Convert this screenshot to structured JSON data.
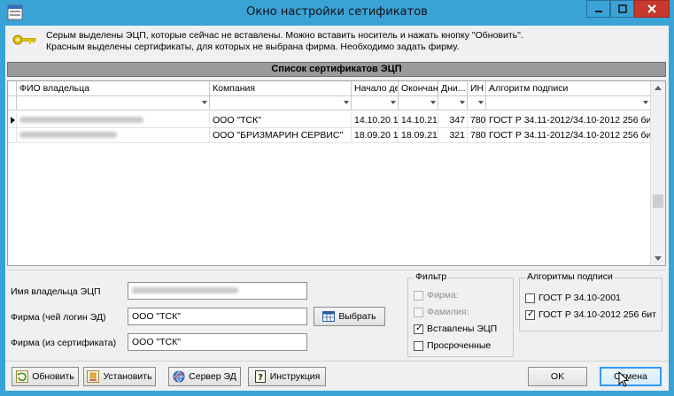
{
  "window": {
    "title": "Окно настройки сетификатов"
  },
  "info": {
    "line1": "Серым выделены ЭЦП, которые сейчас не вставлены. Можно вставить носитель и нажать кнопку \"Обновить\".",
    "line2": "Красным выделены сертификаты, для которых не выбрана фирма. Необходимо задать фирму."
  },
  "grid": {
    "title": "Список сертификатов ЭЦП",
    "columns": [
      "ФИО владельца",
      "Компания",
      "Начало де",
      "Окончан",
      "Дни...",
      "ИН",
      "Алгоритм подписи"
    ],
    "rows": [
      {
        "owner": "",
        "company": "ООО \"ТСК\"",
        "start": "14.10.20 1",
        "end": "14.10.21 '",
        "days": "347",
        "inn": "780",
        "algo": "ГОСТ Р 34.11-2012/34.10-2012 256 бит"
      },
      {
        "owner": "",
        "company": "ООО \"БРИЗМАРИН СЕРВИС\"",
        "start": "18.09.20 1",
        "end": "18.09.21 '",
        "days": "321",
        "inn": "780",
        "algo": "ГОСТ Р 34.11-2012/34.10-2012 256 бит"
      }
    ]
  },
  "form": {
    "owner_label": "Имя владельца ЭЦП",
    "owner_value": "",
    "firm_login_label": "Фирма (чей логин ЭД)",
    "firm_login_value": "ООО \"ТСК\"",
    "select_button": "Выбрать",
    "firm_cert_label": "Фирма (из сертификата)",
    "firm_cert_value": "ООО \"ТСК\""
  },
  "filter": {
    "title": "Фильтр",
    "items": [
      {
        "label": "Фирма:",
        "checked": false,
        "disabled": true
      },
      {
        "label": "Фамилия:",
        "checked": false,
        "disabled": true
      },
      {
        "label": "Вставлены ЭЦП",
        "checked": true,
        "disabled": false
      },
      {
        "label": "Просроченные",
        "checked": false,
        "disabled": false
      }
    ]
  },
  "algorithms": {
    "title": "Алгоритмы подписи",
    "items": [
      {
        "label": "ГОСТ Р 34.10-2001",
        "checked": false
      },
      {
        "label": "ГОСТ Р 34.10-2012 256 бит",
        "checked": true
      }
    ]
  },
  "footer": {
    "refresh": "Обновить",
    "install": "Установить",
    "server": "Сервер ЭД",
    "manual": "Инструкция",
    "ok": "OK",
    "cancel": "Отмена"
  },
  "icons": {
    "app": "key-icon",
    "refresh": "refresh-icon",
    "install": "install-icon",
    "server": "globe-icon",
    "manual": "help-icon",
    "select": "table-icon"
  }
}
